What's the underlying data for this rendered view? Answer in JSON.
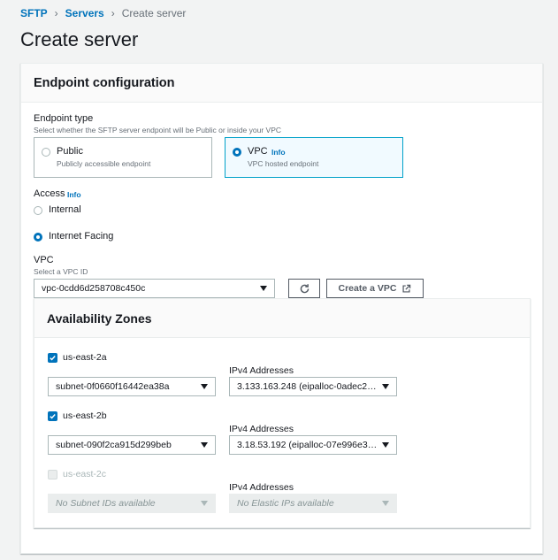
{
  "breadcrumb": {
    "items": [
      "SFTP",
      "Servers"
    ],
    "current": "Create server"
  },
  "page_title": "Create server",
  "panel": {
    "title": "Endpoint configuration",
    "endpoint_type": {
      "label": "Endpoint type",
      "description": "Select whether the SFTP server endpoint will be Public or inside your VPC",
      "options": [
        {
          "title": "Public",
          "desc": "Publicly accessible endpoint",
          "selected": false
        },
        {
          "title": "VPC",
          "info": "Info",
          "desc": "VPC hosted endpoint",
          "selected": true
        }
      ]
    },
    "access": {
      "label": "Access",
      "info": "Info",
      "options": [
        {
          "label": "Internal",
          "selected": false
        },
        {
          "label": "Internet Facing",
          "selected": true
        }
      ]
    },
    "vpc": {
      "label": "VPC",
      "description": "Select a VPC ID",
      "value": "vpc-0cdd6d258708c450c",
      "create_label": "Create a VPC"
    },
    "az": {
      "title": "Availability Zones",
      "ipv4_label": "IPv4 Addresses",
      "zones": [
        {
          "name": "us-east-2a",
          "checked": true,
          "subnet": "subnet-0f0660f16442ea38a",
          "ip": "3.133.163.248 (eipalloc-0adec2…"
        },
        {
          "name": "us-east-2b",
          "checked": true,
          "subnet": "subnet-090f2ca915d299beb",
          "ip": "3.18.53.192 (eipalloc-07e996e3…"
        },
        {
          "name": "us-east-2c",
          "checked": false,
          "subnet": "No Subnet IDs available",
          "ip": "No Elastic IPs available"
        }
      ]
    }
  },
  "colors": {
    "accent": "#0073bb",
    "selected_border": "#00a1c9",
    "selected_bg": "#f1faff"
  }
}
